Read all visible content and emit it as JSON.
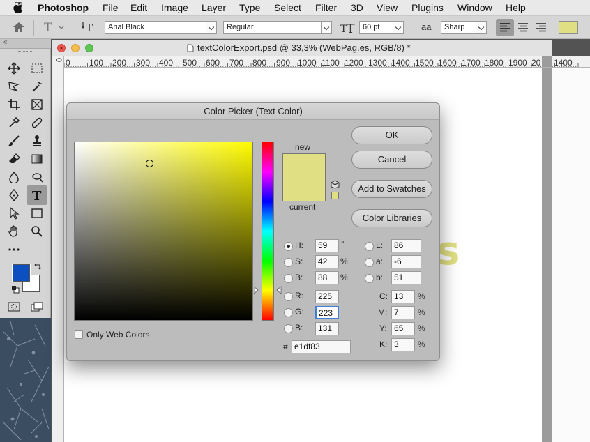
{
  "menubar": {
    "app_name": "Photoshop",
    "items": [
      "File",
      "Edit",
      "Image",
      "Layer",
      "Type",
      "Select",
      "Filter",
      "3D",
      "View",
      "Plugins",
      "Window",
      "Help"
    ]
  },
  "options_bar": {
    "font_family": "Arial Black",
    "font_style": "Regular",
    "font_size": "60 pt",
    "aa_symbol": "a͞a",
    "antialias": "Sharp",
    "text_color": "#e1df83"
  },
  "document": {
    "title": "textColorExport.psd @ 33,3% (WebPag.es, RGB/8) *",
    "ruler_labels": [
      "0",
      "100",
      "200",
      "300",
      "400",
      "500",
      "600",
      "700",
      "800",
      "900",
      "1000",
      "1100",
      "1200",
      "1300",
      "1400",
      "1500",
      "1600",
      "1700",
      "1800",
      "1900",
      "20",
      "1400"
    ],
    "ruler_v_label": "0",
    "canvas_glyph": "s"
  },
  "toolbox": {
    "foreground_color": "#0b4fc0",
    "background_color": "#ffffff"
  },
  "color_picker": {
    "title": "Color Picker (Text Color)",
    "buttons": {
      "ok": "OK",
      "cancel": "Cancel",
      "add_to_swatches": "Add to Swatches",
      "color_libraries": "Color Libraries"
    },
    "new_label": "new",
    "current_label": "current",
    "new_color": "#e1df83",
    "current_color": "#e1df83",
    "hue_degrees": 59,
    "only_web_colors_label": "Only Web Colors",
    "only_web_colors_checked": false,
    "selected_channel": "H",
    "fields": {
      "H": {
        "label": "H:",
        "value": "59",
        "unit": "°"
      },
      "S": {
        "label": "S:",
        "value": "42",
        "unit": "%"
      },
      "B": {
        "label": "B:",
        "value": "88",
        "unit": "%"
      },
      "R": {
        "label": "R:",
        "value": "225"
      },
      "G": {
        "label": "G:",
        "value": "223"
      },
      "Bl": {
        "label": "B:",
        "value": "131"
      },
      "L": {
        "label": "L:",
        "value": "86"
      },
      "a": {
        "label": "a:",
        "value": "-6"
      },
      "b": {
        "label": "b:",
        "value": "51"
      },
      "C": {
        "label": "C:",
        "value": "13",
        "unit": "%"
      },
      "M": {
        "label": "M:",
        "value": "7",
        "unit": "%"
      },
      "Y": {
        "label": "Y:",
        "value": "65",
        "unit": "%"
      },
      "K": {
        "label": "K:",
        "value": "3",
        "unit": "%"
      }
    },
    "hex_label": "#",
    "hex_value": "e1df83"
  }
}
